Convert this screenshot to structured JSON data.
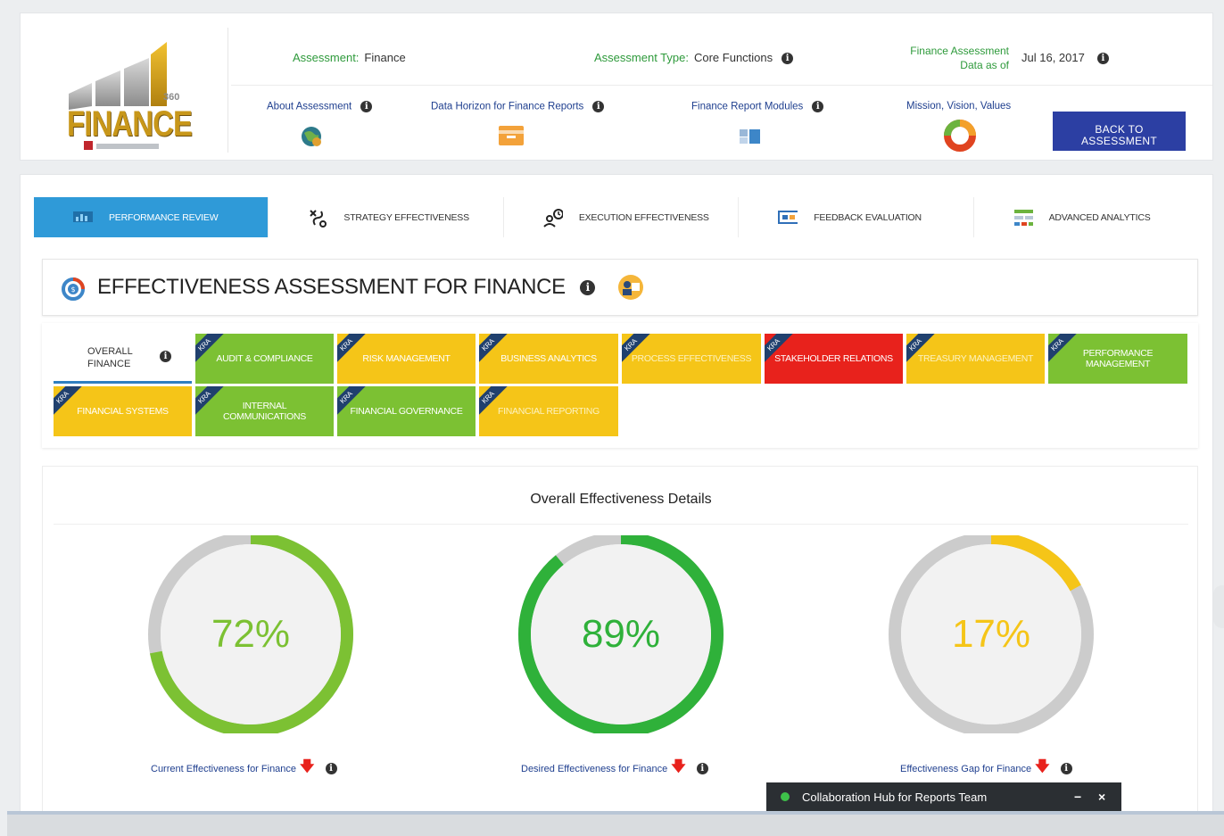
{
  "header": {
    "logo_text": "FINANCE",
    "logo_badge": "360",
    "assessment_label": "Assessment:",
    "assessment_value": "Finance",
    "type_label": "Assessment Type:",
    "type_value": "Core Functions",
    "asof_label_1": "Finance Assessment",
    "asof_label_2": "Data as of",
    "asof_value": "Jul 16, 2017",
    "links": {
      "about": "About Assessment",
      "horizon": "Data Horizon for Finance Reports",
      "modules": "Finance Report Modules",
      "mission": "Mission, Vision, Values"
    },
    "back_button_line1": "BACK TO",
    "back_button_line2": "ASSESSMENT"
  },
  "tabs": [
    {
      "label": "PERFORMANCE REVIEW",
      "icon": "monitor-chart-icon"
    },
    {
      "label": "STRATEGY EFFECTIVENESS",
      "icon": "strategy-path-icon"
    },
    {
      "label": "EXECUTION EFFECTIVENESS",
      "icon": "person-clock-icon"
    },
    {
      "label": "FEEDBACK EVALUATION",
      "icon": "feedback-screen-icon"
    },
    {
      "label": "ADVANCED ANALYTICS",
      "icon": "analytics-grid-icon"
    }
  ],
  "title": "EFFECTIVENESS ASSESSMENT FOR FINANCE",
  "kra_badge": "KRA",
  "overall_tab": {
    "line1": "OVERALL",
    "line2": "FINANCE"
  },
  "kras_row1": [
    {
      "label": "AUDIT & COMPLIANCE",
      "status": "green"
    },
    {
      "label": "RISK MANAGEMENT",
      "status": "yellow"
    },
    {
      "label": "BUSINESS ANALYTICS",
      "status": "yellow"
    },
    {
      "label": "PROCESS EFFECTIVENESS",
      "status": "yellow"
    },
    {
      "label": "STAKEHOLDER RELATIONS",
      "status": "red"
    },
    {
      "label": "TREASURY MANAGEMENT",
      "status": "yellow"
    },
    {
      "label": "PERFORMANCE MANAGEMENT",
      "status": "green"
    }
  ],
  "kras_row2": [
    {
      "label": "FINANCIAL SYSTEMS",
      "status": "yellow"
    },
    {
      "label": "INTERNAL COMMUNICATIONS",
      "status": "green"
    },
    {
      "label": "FINANCIAL GOVERNANCE",
      "status": "green"
    },
    {
      "label": "FINANCIAL REPORTING",
      "status": "yellow"
    }
  ],
  "details": {
    "title": "Overall Effectiveness Details",
    "gauges": [
      {
        "value": 72,
        "text": "72%",
        "color": "#7cc133",
        "label": "Current Effectiveness for Finance"
      },
      {
        "value": 89,
        "text": "89%",
        "color": "#2fb13a",
        "label": "Desired Effectiveness for Finance"
      },
      {
        "value": 17,
        "text": "17%",
        "color": "#f5c518",
        "label": "Effectiveness Gap for Finance"
      }
    ]
  },
  "collab": {
    "label": "Collaboration Hub for Reports Team",
    "minimize": "−",
    "close": "×"
  },
  "colors": {
    "tab_active": "#2f9ad8",
    "back_button": "#2c3fa3",
    "green": "#7cc133",
    "yellow": "#f5c518",
    "red": "#e8221c"
  }
}
